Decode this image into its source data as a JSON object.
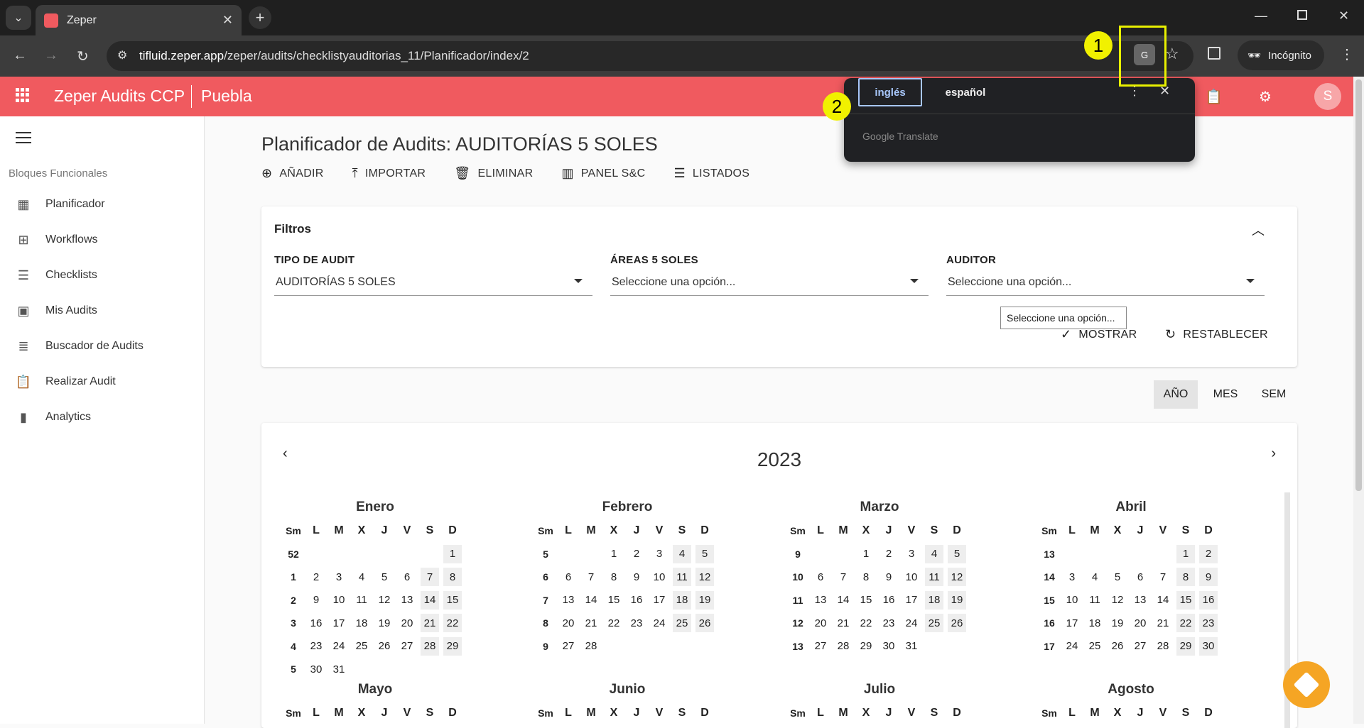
{
  "browser": {
    "tab_title": "Zeper",
    "url_host": "tifluid.zeper.app",
    "url_path": "/zeper/audits/checklistyauditorias_11/Planificador/index/2",
    "incognito_label": "Incógnito"
  },
  "annotations": {
    "marker1": "1",
    "marker2": "2"
  },
  "appbar": {
    "title": "Zeper Audits CCP",
    "site": "Puebla",
    "avatar": "S"
  },
  "sidebar": {
    "section": "Bloques Funcionales",
    "items": [
      {
        "label": "Planificador",
        "icon": "calendar-icon"
      },
      {
        "label": "Workflows",
        "icon": "workflow-icon"
      },
      {
        "label": "Checklists",
        "icon": "checklist-icon"
      },
      {
        "label": "Mis Audits",
        "icon": "account-box-icon"
      },
      {
        "label": "Buscador de Audits",
        "icon": "list-search-icon"
      },
      {
        "label": "Realizar Audit",
        "icon": "clipboard-icon"
      },
      {
        "label": "Analytics",
        "icon": "bar-chart-icon"
      }
    ]
  },
  "page": {
    "title": "Planificador de Audits: AUDITORÍAS 5 SOLES",
    "actions": [
      "AÑADIR",
      "IMPORTAR",
      "ELIMINAR",
      "PANEL S&C",
      "LISTADOS"
    ]
  },
  "filters": {
    "title": "Filtros",
    "tipo_label": "TIPO DE AUDIT",
    "tipo_value": "AUDITORÍAS 5 SOLES",
    "areas_label": "ÁREAS 5 SOLES",
    "areas_value": "Seleccione una opción...",
    "auditor_label": "AUDITOR",
    "auditor_value": "Seleccione una opción...",
    "tooltip": "Seleccione una opción...",
    "show_label": "MOSTRAR",
    "reset_label": "RESTABLECER"
  },
  "views": {
    "year": "AÑO",
    "month": "MES",
    "week": "SEM",
    "selected": "AÑO"
  },
  "translate_popup": {
    "lang_active": "inglés",
    "lang_other": "español",
    "brand": "Google Translate"
  },
  "calendar": {
    "year": "2023",
    "day_headers": [
      "Sm",
      "L",
      "M",
      "X",
      "J",
      "V",
      "S",
      "D"
    ],
    "months": [
      {
        "name": "Enero",
        "rows": [
          [
            "52",
            "",
            "",
            "",
            "",
            "",
            "",
            "1"
          ],
          [
            "1",
            "2",
            "3",
            "4",
            "5",
            "6",
            "7",
            "8"
          ],
          [
            "2",
            "9",
            "10",
            "11",
            "12",
            "13",
            "14",
            "15"
          ],
          [
            "3",
            "16",
            "17",
            "18",
            "19",
            "20",
            "21",
            "22"
          ],
          [
            "4",
            "23",
            "24",
            "25",
            "26",
            "27",
            "28",
            "29"
          ],
          [
            "5",
            "30",
            "31",
            "",
            "",
            "",
            "",
            ""
          ]
        ]
      },
      {
        "name": "Febrero",
        "rows": [
          [
            "5",
            "",
            "",
            "1",
            "2",
            "3",
            "4",
            "5"
          ],
          [
            "6",
            "6",
            "7",
            "8",
            "9",
            "10",
            "11",
            "12"
          ],
          [
            "7",
            "13",
            "14",
            "15",
            "16",
            "17",
            "18",
            "19"
          ],
          [
            "8",
            "20",
            "21",
            "22",
            "23",
            "24",
            "25",
            "26"
          ],
          [
            "9",
            "27",
            "28",
            "",
            "",
            "",
            "",
            ""
          ]
        ]
      },
      {
        "name": "Marzo",
        "rows": [
          [
            "9",
            "",
            "",
            "1",
            "2",
            "3",
            "4",
            "5"
          ],
          [
            "10",
            "6",
            "7",
            "8",
            "9",
            "10",
            "11",
            "12"
          ],
          [
            "11",
            "13",
            "14",
            "15",
            "16",
            "17",
            "18",
            "19"
          ],
          [
            "12",
            "20",
            "21",
            "22",
            "23",
            "24",
            "25",
            "26"
          ],
          [
            "13",
            "27",
            "28",
            "29",
            "30",
            "31",
            "",
            ""
          ]
        ]
      },
      {
        "name": "Abril",
        "rows": [
          [
            "13",
            "",
            "",
            "",
            "",
            "",
            "1",
            "2"
          ],
          [
            "14",
            "3",
            "4",
            "5",
            "6",
            "7",
            "8",
            "9"
          ],
          [
            "15",
            "10",
            "11",
            "12",
            "13",
            "14",
            "15",
            "16"
          ],
          [
            "16",
            "17",
            "18",
            "19",
            "20",
            "21",
            "22",
            "23"
          ],
          [
            "17",
            "24",
            "25",
            "26",
            "27",
            "28",
            "29",
            "30"
          ]
        ]
      },
      {
        "name": "Mayo",
        "rows": []
      },
      {
        "name": "Junio",
        "rows": []
      },
      {
        "name": "Julio",
        "rows": []
      },
      {
        "name": "Agosto",
        "rows": []
      }
    ]
  }
}
